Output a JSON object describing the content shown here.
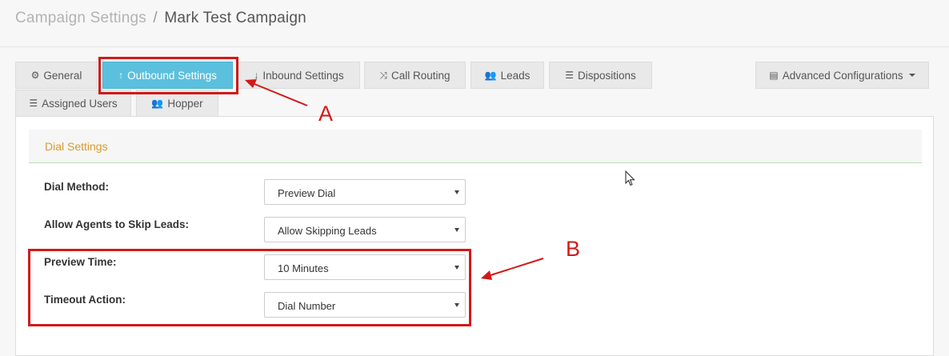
{
  "breadcrumb": {
    "parent": "Campaign Settings",
    "separator": "/",
    "current": "Mark Test Campaign"
  },
  "tabs": [
    {
      "label": "General",
      "icon": "gears-icon",
      "glyph": "⚙"
    },
    {
      "label": "Outbound Settings",
      "icon": "arrow-up-icon",
      "glyph": "↑"
    },
    {
      "label": "Inbound Settings",
      "icon": "arrow-down-icon",
      "glyph": "↓"
    },
    {
      "label": "Call Routing",
      "icon": "random-icon",
      "glyph": "⤨"
    },
    {
      "label": "Leads",
      "icon": "users-icon",
      "glyph": "👥"
    },
    {
      "label": "Dispositions",
      "icon": "list-icon",
      "glyph": "☰"
    },
    {
      "label": "Advanced Configurations",
      "icon": "tasks-icon",
      "glyph": "▤"
    },
    {
      "label": "Assigned Users",
      "icon": "list-ordered-icon",
      "glyph": "☰"
    },
    {
      "label": "Hopper",
      "icon": "users-icon",
      "glyph": "👥"
    }
  ],
  "active_tab": "Outbound Settings",
  "section": {
    "title": "Dial Settings"
  },
  "form": [
    {
      "label": "Dial Method:",
      "value": "Preview Dial"
    },
    {
      "label": "Allow Agents to Skip Leads:",
      "value": "Allow Skipping Leads"
    },
    {
      "label": "Preview Time:",
      "value": "10 Minutes"
    },
    {
      "label": "Timeout Action:",
      "value": "Dial Number"
    }
  ],
  "annotations": {
    "a": "A",
    "b": "B",
    "color": "#d21919"
  },
  "colors": {
    "active_tab": "#5bc0de",
    "section_title": "#d89a2c",
    "section_border": "#b6dcae"
  }
}
